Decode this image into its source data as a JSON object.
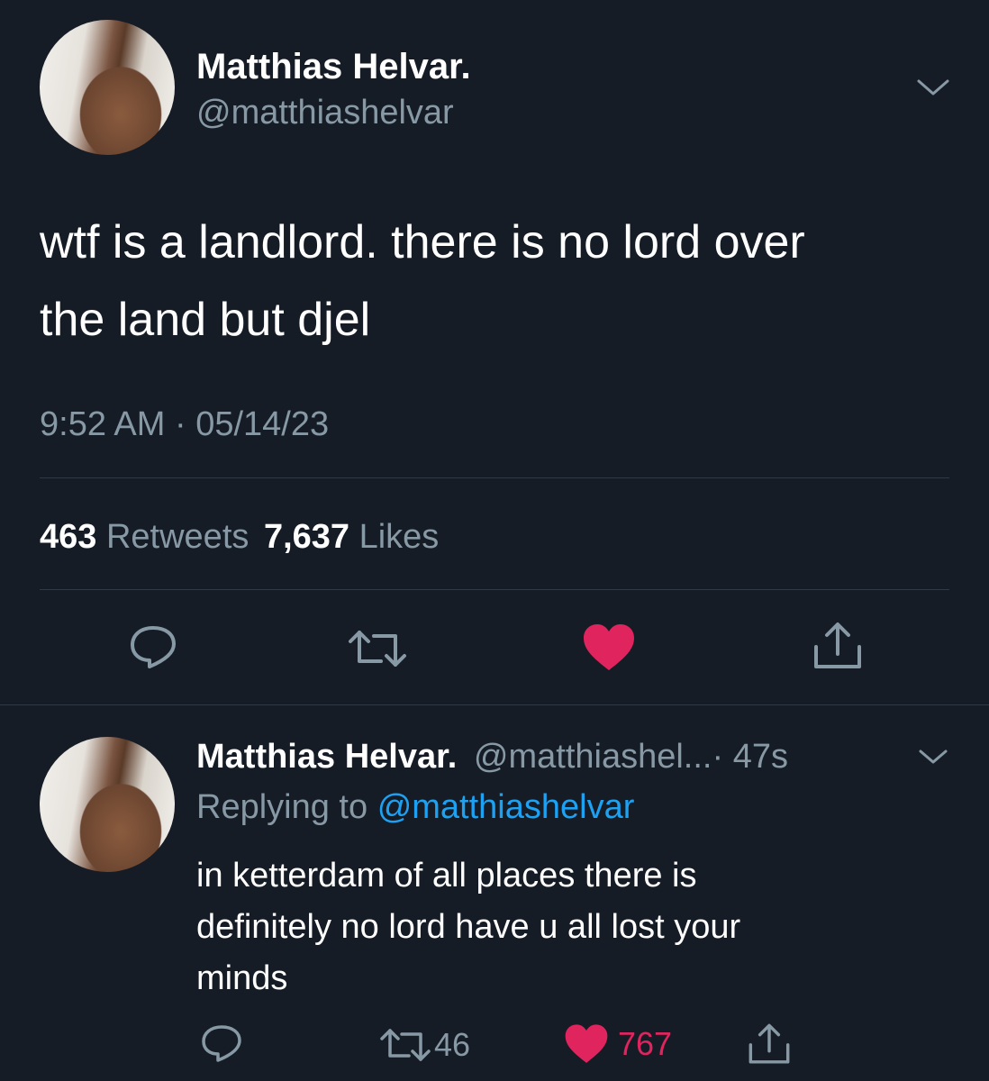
{
  "main_tweet": {
    "display_name": "Matthias Helvar.",
    "handle": "@matthiashelvar",
    "text_line1": "wtf is a landlord. there is no lord over",
    "text_line2": "the land but djel",
    "timestamp": "9:52 AM · 05/14/23",
    "retweets_count": "463",
    "retweets_label": "Retweets",
    "likes_count": "7,637",
    "likes_label": "Likes",
    "liked": true
  },
  "reply": {
    "display_name": "Matthias Helvar.",
    "handle_truncated": "@matthiashel...",
    "time_ago": "· 47s",
    "replying_label": "Replying to",
    "replying_handle": "@matthiashelvar",
    "text_line1": "in ketterdam of all places there is",
    "text_line2": "definitely no lord have u all lost your",
    "text_line3": "minds",
    "retweet_count": "46",
    "like_count": "767",
    "liked": true
  },
  "colors": {
    "background": "#151c26",
    "muted": "#8899a6",
    "link": "#1da1f2",
    "like": "#e0245e"
  },
  "icons": [
    "chevron-down-icon",
    "reply-icon",
    "retweet-icon",
    "heart-icon",
    "share-icon"
  ]
}
